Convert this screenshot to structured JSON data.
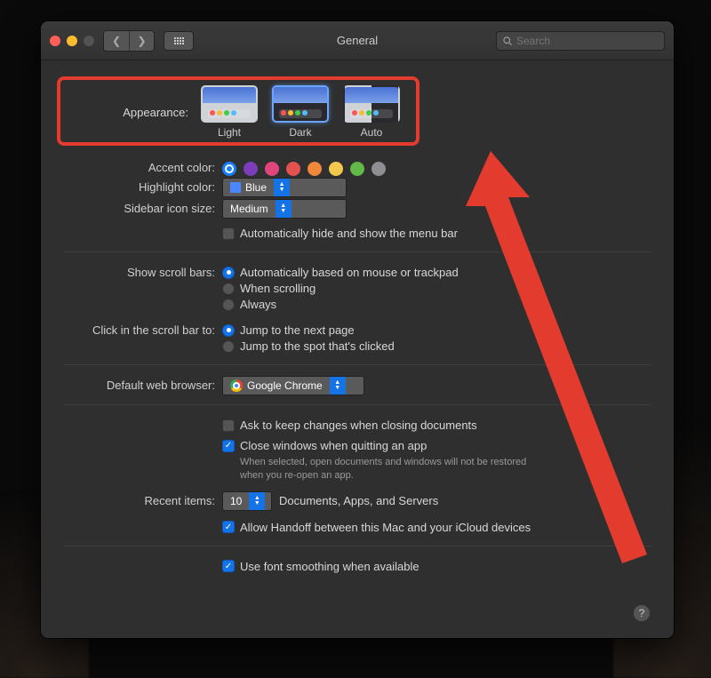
{
  "window": {
    "title": "General"
  },
  "search": {
    "placeholder": "Search"
  },
  "appearance": {
    "label": "Appearance:",
    "options": {
      "light": "Light",
      "dark": "Dark",
      "auto": "Auto"
    },
    "selected": "dark"
  },
  "accent": {
    "label": "Accent color:",
    "colors": [
      "#157efb",
      "#7b3db9",
      "#e0457e",
      "#e35151",
      "#f0873b",
      "#f2c94c",
      "#62ba46",
      "#8e8e93"
    ],
    "selected_index": 0
  },
  "highlight": {
    "label": "Highlight color:",
    "value": "Blue"
  },
  "sidebar_size": {
    "label": "Sidebar icon size:",
    "value": "Medium"
  },
  "menu_autohide": {
    "label": "Automatically hide and show the menu bar",
    "checked": false
  },
  "scrollbars": {
    "label": "Show scroll bars:",
    "options": {
      "auto": "Automatically based on mouse or trackpad",
      "scrolling": "When scrolling",
      "always": "Always"
    },
    "selected": "auto"
  },
  "scroll_click": {
    "label": "Click in the scroll bar to:",
    "options": {
      "next": "Jump to the next page",
      "spot": "Jump to the spot that's clicked"
    },
    "selected": "next"
  },
  "browser": {
    "label": "Default web browser:",
    "value": "Google Chrome"
  },
  "ask_changes": {
    "label": "Ask to keep changes when closing documents",
    "checked": false
  },
  "close_windows": {
    "label": "Close windows when quitting an app",
    "checked": true,
    "hint": "When selected, open documents and windows will not be restored when you re-open an app."
  },
  "recent": {
    "label": "Recent items:",
    "value": "10",
    "suffix": "Documents, Apps, and Servers"
  },
  "handoff": {
    "label": "Allow Handoff between this Mac and your iCloud devices",
    "checked": true
  },
  "font_smoothing": {
    "label": "Use font smoothing when available",
    "checked": true
  },
  "help_tooltip": "?"
}
